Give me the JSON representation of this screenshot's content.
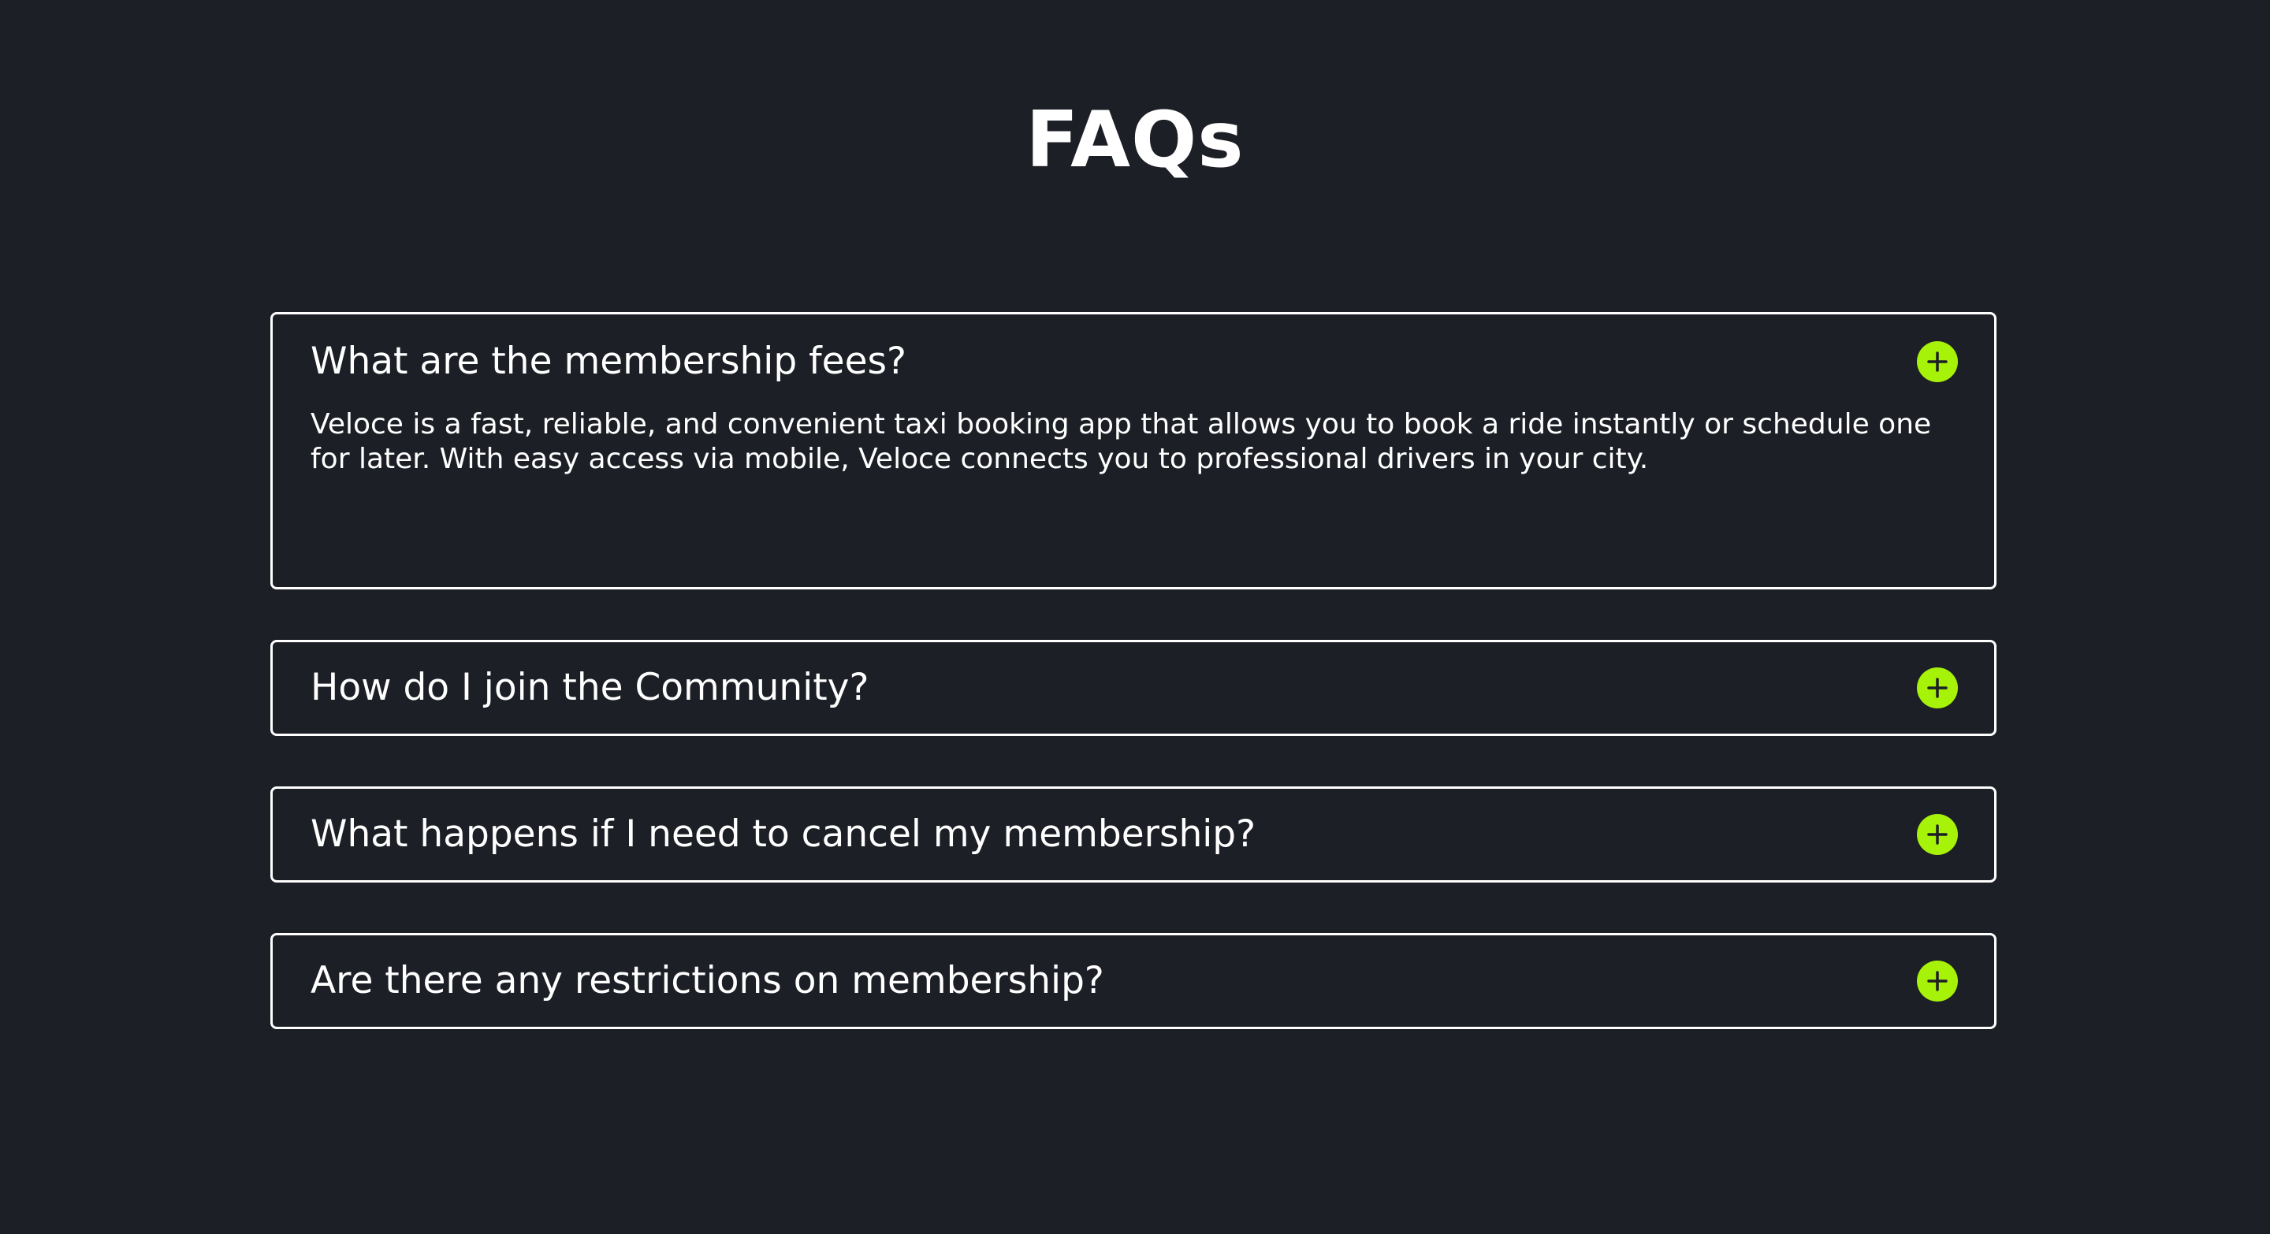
{
  "page": {
    "title": "FAQs"
  },
  "faqs": [
    {
      "question": "What are the membership fees?",
      "answer": "Veloce is a fast, reliable, and convenient taxi booking app that allows you to book a ride instantly or schedule one for later. With easy access via mobile, Veloce connects you to professional drivers in your city.",
      "expanded": true,
      "icon": "plus-circle-icon"
    },
    {
      "question": "How do I join the Community?",
      "expanded": false,
      "icon": "plus-circle-icon"
    },
    {
      "question": "What happens if I need to cancel my membership?",
      "expanded": false,
      "icon": "plus-circle-icon"
    },
    {
      "question": "Are there any restrictions on membership?",
      "expanded": false,
      "icon": "plus-circle-icon"
    }
  ],
  "colors": {
    "background": "#1d1f26",
    "text": "#ffffff",
    "accent": "#a6f209",
    "border": "#ffffff"
  }
}
